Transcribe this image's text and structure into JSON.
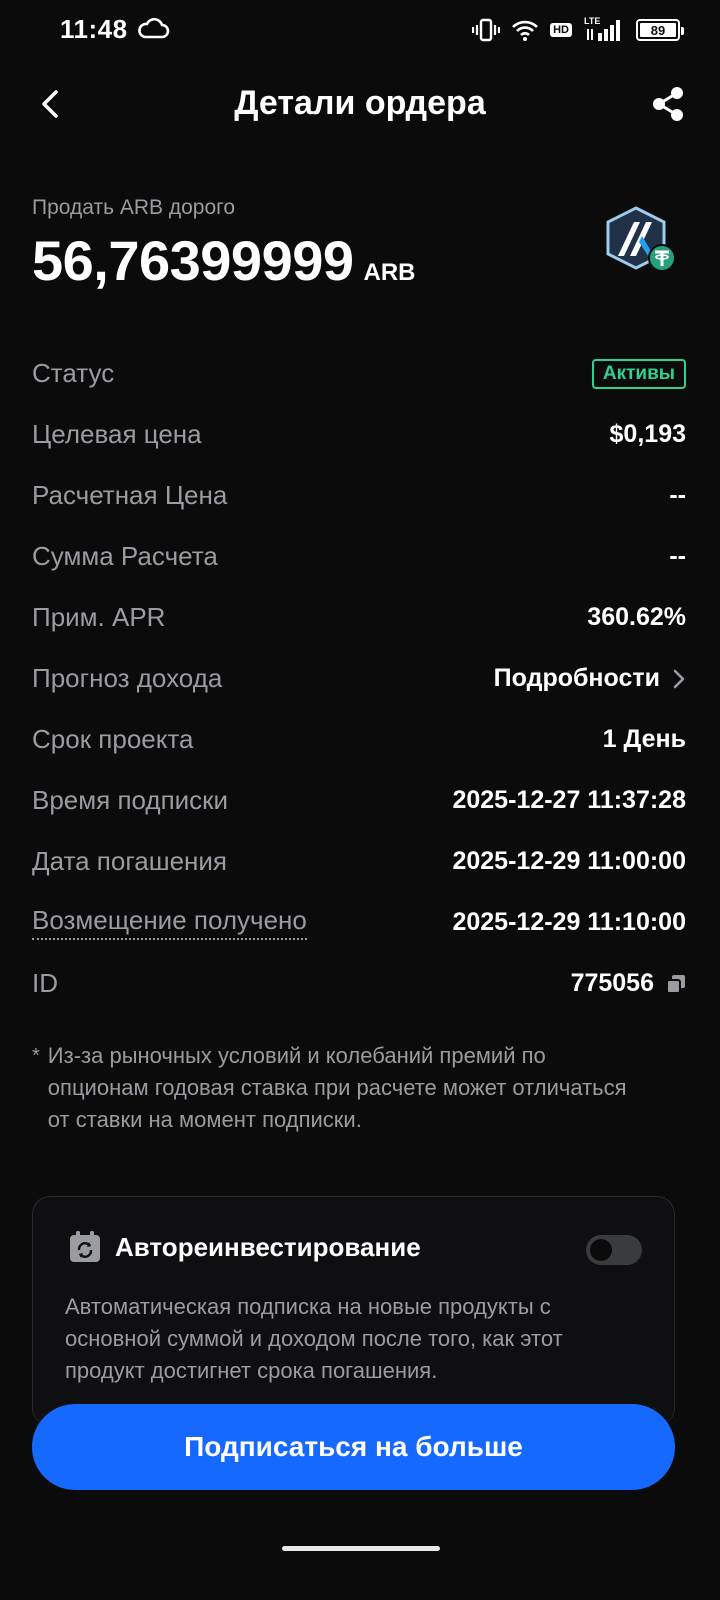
{
  "status_bar": {
    "time": "11:48",
    "hd": "HD",
    "lte": "LTE",
    "battery_level": "89",
    "icons": [
      "cloud-icon",
      "vibrate-icon",
      "wifi-icon",
      "signal-icon",
      "battery-icon"
    ]
  },
  "header": {
    "title": "Детали ордера",
    "back_icon": "chevron-left-icon",
    "share_icon": "share-icon"
  },
  "summary": {
    "label": "Продать ARB дорого",
    "amount": "56,76399999",
    "unit": "ARB",
    "logo": "arbitrum-tether-icon"
  },
  "details": [
    {
      "label": "Статус",
      "value": "Активы"
    },
    {
      "label": "Целевая цена",
      "value": "$0,193"
    },
    {
      "label": "Расчетная Цена",
      "value": "--"
    },
    {
      "label": "Сумма Расчета",
      "value": "--"
    },
    {
      "label": "Прим. APR",
      "value": "360.62%"
    },
    {
      "label": "Прогноз дохода",
      "value": "Подробности"
    },
    {
      "label": "Срок проекта",
      "value": "1 День"
    },
    {
      "label": "Время подписки",
      "value": "2025-12-27 11:37:28"
    },
    {
      "label": "Дата погашения",
      "value": "2025-12-29 11:00:00"
    },
    {
      "label": "Возмещение получено",
      "value": "2025-12-29 11:10:00"
    },
    {
      "label": "ID",
      "value": "775056"
    }
  ],
  "footnote": {
    "star": "*",
    "text": "Из-за рыночных условий и колебаний премий по опционам годовая ставка при расчете может отличаться от ставки на момент подписки."
  },
  "reinvest": {
    "title": "Автореинвестирование",
    "description": "Автоматическая подписка на новые продукты с основной суммой и доходом после того, как этот продукт достигнет срока погашения.",
    "enabled": false
  },
  "cta": {
    "label": "Подписаться на больше"
  },
  "colors": {
    "background": "#0b0b0c",
    "accent": "#1569ff",
    "status_green": "#2fd18e",
    "muted_text": "#9a9ca1"
  }
}
